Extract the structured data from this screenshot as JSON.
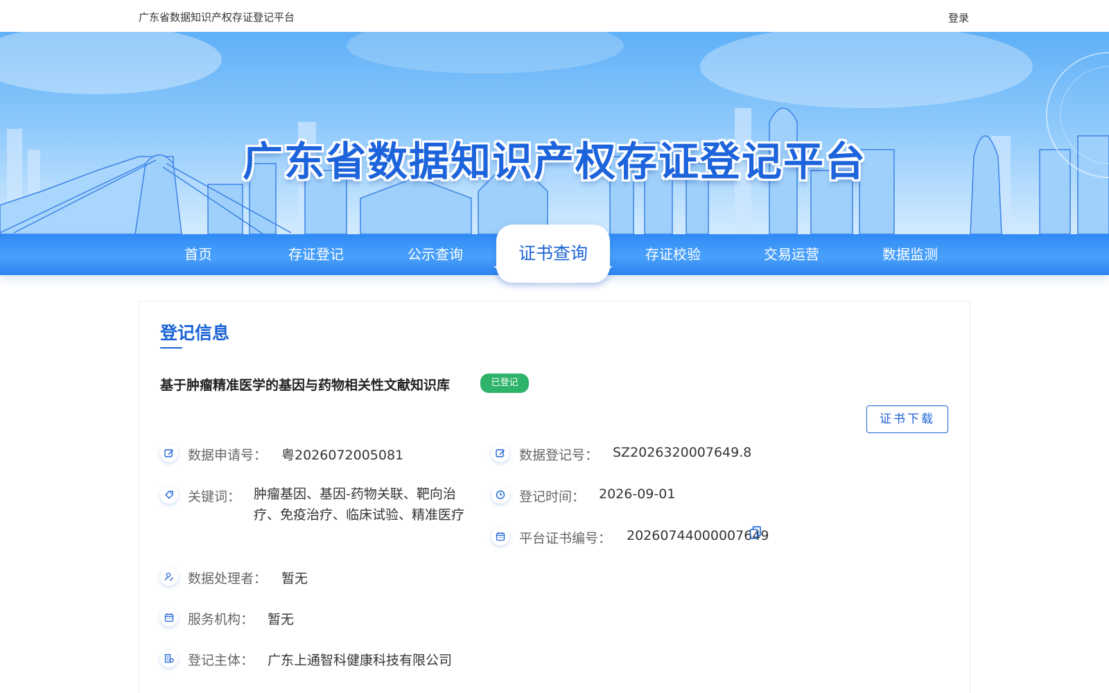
{
  "topbar": {
    "site_name": "广东省数据知识产权存证登记平台",
    "login_label": "登录"
  },
  "banner": {
    "title": "广东省数据知识产权存证登记平台"
  },
  "nav": {
    "items": [
      "首页",
      "存证登记",
      "公示查询",
      "证书查询",
      "存证校验",
      "交易运营",
      "数据监测"
    ],
    "active": "证书查询"
  },
  "section": {
    "title": "登记信息"
  },
  "record": {
    "title": "基于肿瘤精准医学的基因与药物相关性文献知识库",
    "status": "已登记",
    "download_label": "证书下载",
    "fields": {
      "application_no": {
        "label": "数据申请号：",
        "value": "粤2026072005081",
        "icon": "edit-icon"
      },
      "registration_no": {
        "label": "数据登记号：",
        "value": "SZ2026320007649.8",
        "icon": "edit-icon"
      },
      "keywords": {
        "label": "关键词：",
        "value": "肿瘤基因、基因-药物关联、靶向治疗、免疫治疗、临床试验、精准医疗",
        "icon": "tag-icon"
      },
      "registration_time": {
        "label": "登记时间：",
        "value": "2026-09-01",
        "icon": "clock-icon"
      },
      "certificate_no": {
        "label": "平台证书编号：",
        "value": "20260744000007649",
        "icon": "calendar-icon"
      },
      "processor": {
        "label": "数据处理者：",
        "value": "暂无",
        "icon": "user-edit-icon"
      },
      "service_org": {
        "label": "服务机构：",
        "value": "暂无",
        "icon": "calendar-icon"
      },
      "subject": {
        "label": "登记主体：",
        "value": "广东上通智科健康科技有限公司",
        "icon": "building-icon"
      }
    }
  },
  "colors": {
    "primary": "#1a63d6",
    "nav_bg": "#3a93f8",
    "status_green": "#2db36a"
  }
}
